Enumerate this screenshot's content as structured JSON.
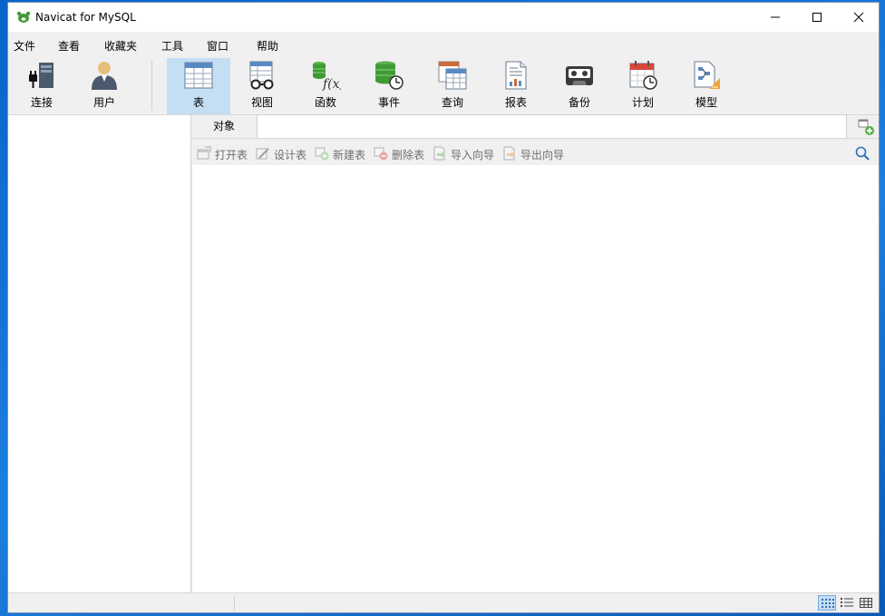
{
  "window": {
    "title": "Navicat for MySQL",
    "controls": [
      "minimize-icon",
      "maximize-icon",
      "close-icon"
    ]
  },
  "menu": {
    "file": "文件",
    "view": "查看",
    "favorites": "收藏夹",
    "tools": "工具",
    "window": "窗口",
    "help": "帮助"
  },
  "toolbar": {
    "connection": "连接",
    "user": "用户",
    "table": "表",
    "view": "视图",
    "function": "函数",
    "event": "事件",
    "query": "查询",
    "report": "报表",
    "backup": "备份",
    "schedule": "计划",
    "model": "模型",
    "active": "table"
  },
  "object_tab": {
    "label": "对象"
  },
  "object_toolbar": {
    "open_table": "打开表",
    "design_table": "设计表",
    "new_table": "新建表",
    "delete_table": "删除表",
    "import_wizard": "导入向导",
    "export_wizard": "导出向导"
  },
  "status_bar": {
    "view_modes": [
      "list-view-icon",
      "detail-view-icon",
      "grid-view-icon"
    ],
    "active_view": "list-view-icon"
  },
  "colors": {
    "accent_selected": "#c4def4",
    "navicat_green": "#3f9b35",
    "desktop_blue": "#1c7fe0"
  }
}
